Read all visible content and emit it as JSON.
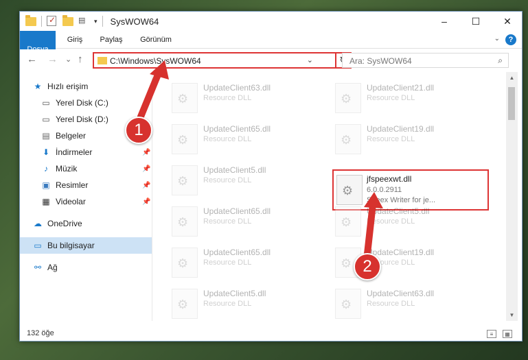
{
  "titlebar": {
    "title": "SysWOW64",
    "minimize": "–",
    "maximize": "☐",
    "close": "✕"
  },
  "ribbon": {
    "tabs": [
      "Dosya",
      "Giriş",
      "Paylaş",
      "Görünüm"
    ],
    "help": "?"
  },
  "nav": {
    "back": "←",
    "forward": "→",
    "recent": "⌄",
    "up": "↑",
    "address": "C:\\Windows\\SysWOW64",
    "refresh": "↻",
    "search_placeholder": "Ara: SysWOW64"
  },
  "sidebar": {
    "items": [
      {
        "label": "Hızlı erişim",
        "icon": "star-icon"
      },
      {
        "label": "Yerel Disk (C:)",
        "icon": "drive-icon"
      },
      {
        "label": "Yerel Disk (D:)",
        "icon": "drive-icon"
      },
      {
        "label": "Belgeler",
        "icon": "documents-icon"
      },
      {
        "label": "İndirmeler",
        "icon": "downloads-icon"
      },
      {
        "label": "Müzik",
        "icon": "music-icon"
      },
      {
        "label": "Resimler",
        "icon": "pictures-icon"
      },
      {
        "label": "Videolar",
        "icon": "videos-icon"
      },
      {
        "label": "OneDrive",
        "icon": "cloud-icon"
      },
      {
        "label": "Bu bilgisayar",
        "icon": "computer-icon"
      },
      {
        "label": "Ağ",
        "icon": "network-icon"
      }
    ]
  },
  "files": [
    {
      "name": "UpdateClient63.dll",
      "type": "Resource DLL"
    },
    {
      "name": "UpdateClient21.dll",
      "type": "Resource DLL"
    },
    {
      "name": "UpdateClient65.dll",
      "type": "Resource DLL"
    },
    {
      "name": "UpdateClient19.dll",
      "type": "Resource DLL"
    },
    {
      "name": "UpdateClient5.dll",
      "type": "Resource DLL"
    },
    {
      "name": "jfspeexwt.dll",
      "version": "6.0.0.2911",
      "desc": "Speex Writer for je..."
    },
    {
      "name": "UpdateClient65.dll",
      "type": "Resource DLL"
    },
    {
      "name": "UpdateClient5.dll",
      "type": "Resource DLL"
    },
    {
      "name": "UpdateClient65.dll",
      "type": "Resource DLL"
    },
    {
      "name": "UpdateClient19.dll",
      "type": "Resource DLL"
    },
    {
      "name": "UpdateClient5.dll",
      "type": "Resource DLL"
    },
    {
      "name": "UpdateClient63.dll",
      "type": "Resource DLL"
    }
  ],
  "status": {
    "count": "132 öğe"
  },
  "annotations": {
    "step1": "1",
    "step2": "2"
  },
  "colors": {
    "accent": "#1979ca",
    "highlight": "#d33333",
    "badge": "#d7322e"
  }
}
